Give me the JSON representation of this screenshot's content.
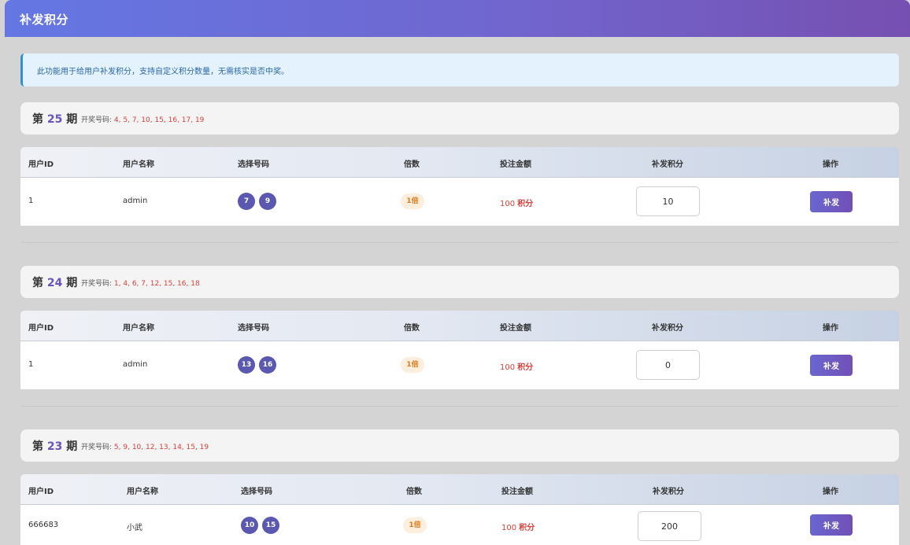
{
  "header": {
    "title": "补发积分"
  },
  "notice": {
    "text": "此功能用于给用户补发积分，支持自定义积分数量，无需核实是否中奖。"
  },
  "labels": {
    "period_prefix": "第",
    "period_suffix": "期",
    "draw_numbers_label": "开奖号码:",
    "points_unit": "积分"
  },
  "table_headers": [
    "用户ID",
    "用户名称",
    "选择号码",
    "倍数",
    "投注金额",
    "补发积分",
    "操作"
  ],
  "periods": [
    {
      "period": "25",
      "draw_numbers": "4, 5, 7, 10, 15, 16, 17, 19",
      "rows": [
        {
          "user_id": "1",
          "username": "admin",
          "numbers": [
            "7",
            "9"
          ],
          "multiplier": "1倍",
          "amount": "100",
          "reissue_points": "10",
          "action": "补发"
        }
      ]
    },
    {
      "period": "24",
      "draw_numbers": "1, 4, 6, 7, 12, 15, 16, 18",
      "rows": [
        {
          "user_id": "1",
          "username": "admin",
          "numbers": [
            "13",
            "16"
          ],
          "multiplier": "1倍",
          "amount": "100",
          "reissue_points": "0",
          "action": "补发"
        }
      ]
    },
    {
      "period": "23",
      "draw_numbers": "5, 9, 10, 12, 13, 14, 15, 19",
      "rows": [
        {
          "user_id": "666683",
          "username": "小武",
          "numbers": [
            "10",
            "15"
          ],
          "multiplier": "1倍",
          "amount": "100",
          "reissue_points": "200",
          "action": "补发"
        }
      ]
    }
  ],
  "colors": {
    "header_gradient_start": "#6477e3",
    "header_gradient_end": "#7650b1",
    "accent_purple": "#6a54b8",
    "draw_number_red": "#d9413a",
    "multiplier_orange": "#e57a17",
    "notice_blue": "#2f8fd7"
  }
}
